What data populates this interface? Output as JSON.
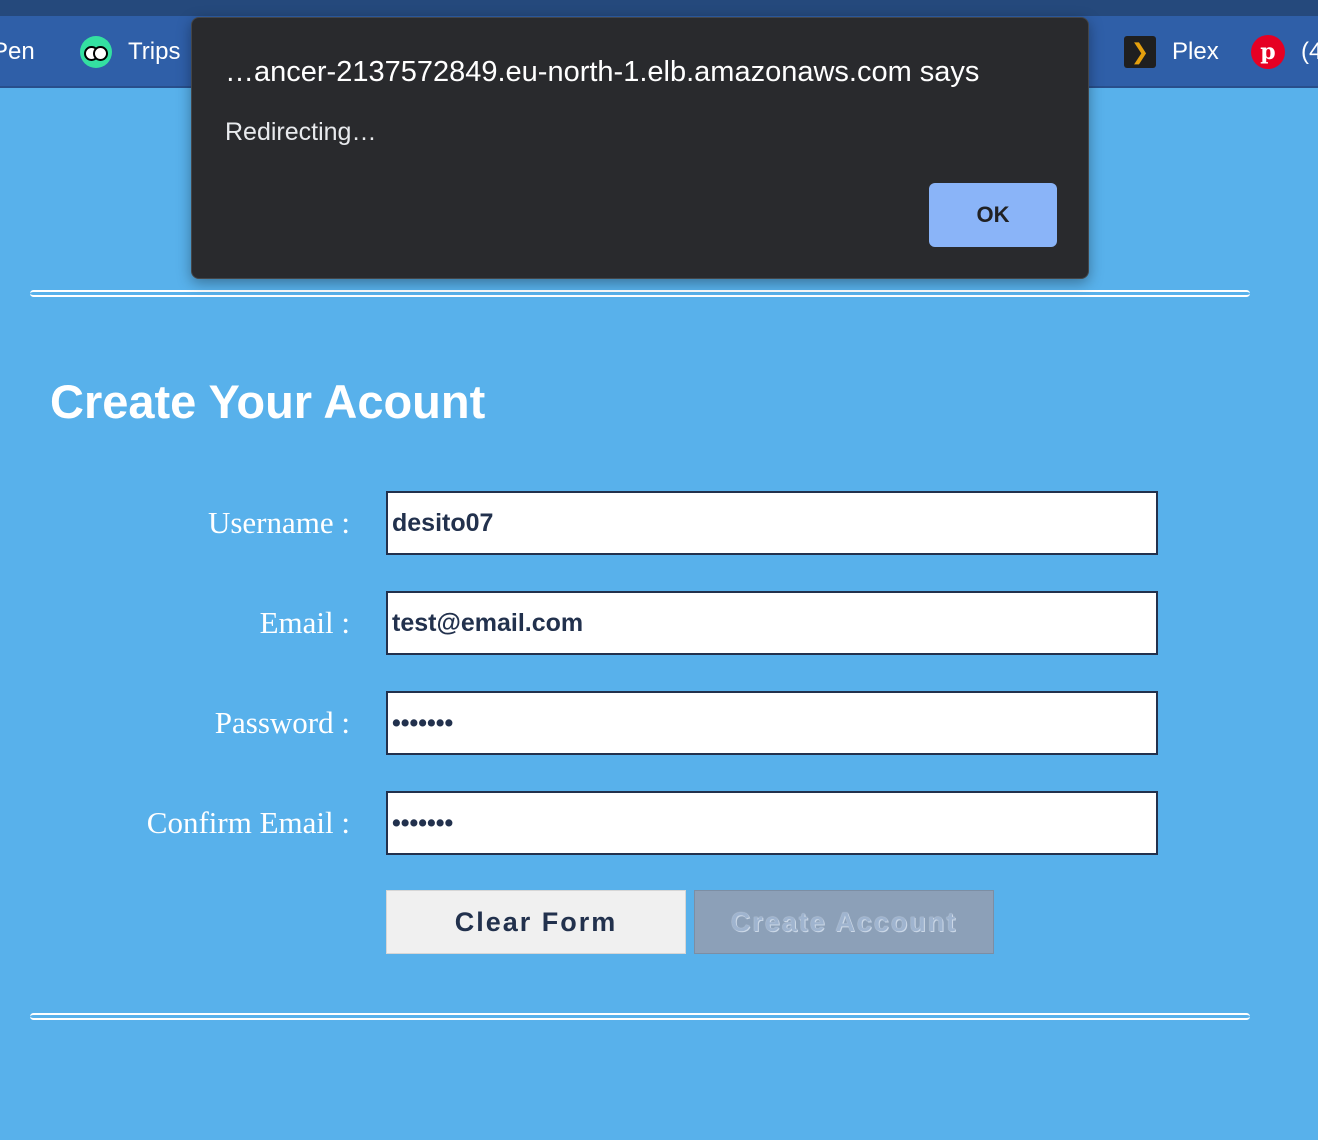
{
  "bookmarks": {
    "codepen_label": "Pen",
    "trips_label": "Trips",
    "plex_label": "Plex",
    "pinterest_label": "(4"
  },
  "dialog": {
    "origin": "…ancer-2137572849.eu-north-1.elb.amazonaws.com says",
    "message": "Redirecting…",
    "ok_label": "OK"
  },
  "form": {
    "title": "Create Your Acount",
    "fields": [
      {
        "label": "Username :",
        "value": "desito07",
        "type": "text"
      },
      {
        "label": "Email :",
        "value": "test@email.com",
        "type": "text"
      },
      {
        "label": "Password :",
        "value": "•••••••",
        "type": "password"
      },
      {
        "label": "Confirm Email :",
        "value": "•••••••",
        "type": "password"
      }
    ],
    "clear_label": "Clear Form",
    "create_label": "Create Account",
    "create_disabled": true
  },
  "colors": {
    "page_background": "#58b1eb",
    "bookmarks_bar": "#2f5fa8",
    "dialog_background": "#292a2d",
    "dialog_button": "#8ab4f8",
    "input_border": "#22314d"
  },
  "icons": {
    "trips": "tripadvisor-owl-icon",
    "plex": "plex-chevron-icon",
    "pinterest": "pinterest-icon"
  }
}
